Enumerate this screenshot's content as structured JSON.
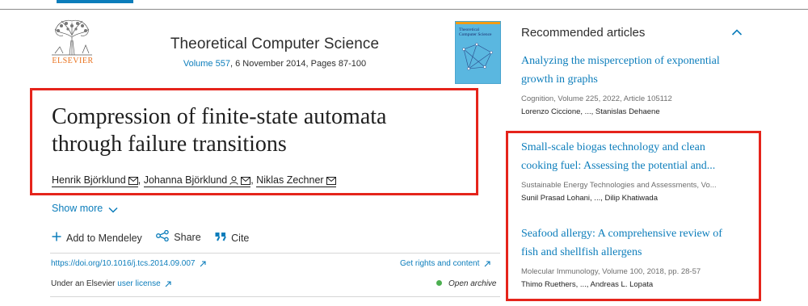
{
  "journal": {
    "name": "Theoretical Computer Science",
    "volume_link": "Volume 557",
    "issue_info": ", 6 November 2014, Pages 87-100",
    "publisher_wordmark": "ELSEVIER",
    "cover_title_line1": "Theoretical",
    "cover_title_line2": "Computer Science"
  },
  "article": {
    "title_line1": "Compression of finite-state automata",
    "title_line2": "through failure transitions",
    "authors": [
      {
        "name": "Henrik Björklund"
      },
      {
        "name": "Johanna Björklund"
      },
      {
        "name": "Niklas Zechner"
      }
    ],
    "sep": ",",
    "show_more": "Show more",
    "actions": {
      "mendeley": "Add to Mendeley",
      "share": "Share",
      "cite": "Cite"
    },
    "doi": "https://doi.org/10.1016/j.tcs.2014.09.007",
    "rights": "Get rights and content",
    "license_prefix": "Under an Elsevier ",
    "license_link": "user license",
    "open_archive": "Open archive"
  },
  "recommended": {
    "heading": "Recommended articles",
    "items": [
      {
        "title_line1": "Analyzing the misperception of exponential",
        "title_line2": "growth in graphs",
        "source": "Cognition, Volume 225, 2022, Article 105112",
        "authors": "Lorenzo Ciccione, ..., Stanislas Dehaene"
      },
      {
        "title_line1": "Small-scale biogas technology and clean",
        "title_line2": "cooking fuel: Assessing the potential and...",
        "source": "Sustainable Energy Technologies and Assessments, Vo...",
        "authors": "Sunil Prasad Lohani, ..., Dilip Khatiwada"
      },
      {
        "title_line1": "Seafood allergy: A comprehensive review of",
        "title_line2": "fish and shellfish allergens",
        "source": "Molecular Immunology, Volume 100, 2018, pp. 28-57",
        "authors": "Thimo Ruethers, ..., Andreas L. Lopata"
      }
    ]
  },
  "colors": {
    "link": "#0c7dbb",
    "highlight_box": "#e5241b",
    "publisher_orange": "#e9711c",
    "open_dot": "#4caf50"
  }
}
